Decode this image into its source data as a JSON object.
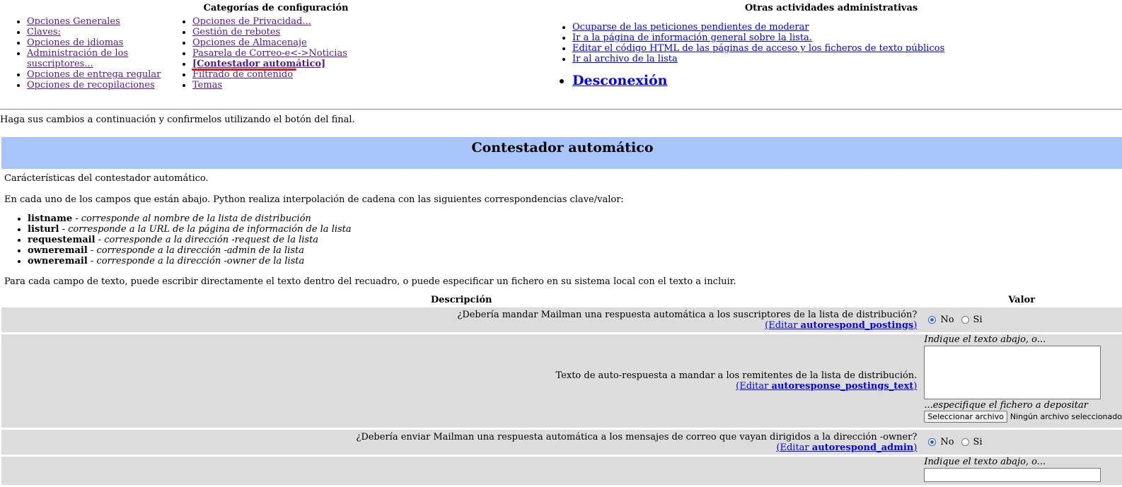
{
  "nav": {
    "config_heading": "Categorías de configuración",
    "config_list_1": [
      "Opciones Generales",
      "Claves:",
      "Opciones de idiomas",
      "Administración de los suscriptores...",
      "Opciones de entrega regular",
      "Opciones de recopilaciones"
    ],
    "config_list_2": [
      "Opciones de Privacidad...",
      "Gestión de rebotes",
      "Opciones de Almacenaje",
      "Pasarela de Correo-e<->Noticias",
      "[Contestador automático]",
      "Filtrado de contenido",
      "Temas"
    ],
    "admin_heading": "Otras actividades administrativas",
    "admin_list": [
      "Ocuparse de las peticiones pendientes de moderar",
      "Ir a la página de información general sobre la lista.",
      "Editar el código HTML de las páginas de acceso y los ficheros de texto públicos",
      "Ir al archivo de la lista"
    ],
    "logout": "Desconexión"
  },
  "intro": "Haga sus cambios a continuación y confirmelos utilizando el botón del final.",
  "section_title": "Contestador automático",
  "body": {
    "p1": "Carácterísticas del contestador automático.",
    "p2": "En cada uno de los campos que están abajo. Python realiza interpolación de cadena con las siguientes correspondencias clave/valor:",
    "keys": [
      {
        "key": "listname",
        "desc": "corresponde al nombre de la lista de distribución"
      },
      {
        "key": "listurl",
        "desc": "corresponde a la URL de la página de información de la lista"
      },
      {
        "key": "requestemail",
        "desc": "corresponde a la dirección -request de la lista"
      },
      {
        "key": "owneremail",
        "desc": "corresponde a la dirección -admin de la lista"
      },
      {
        "key": "owneremail",
        "desc": "corresponde a la dirección -owner de la lista"
      }
    ],
    "p3": "Para cada campo de texto, puede escribir directamente el texto dentro del recuadro, o puede especificar un fichero en su sistema local con el texto a incluir."
  },
  "table": {
    "col_desc": "Descripción",
    "col_value": "Valor",
    "edit_prefix": "(Editar ",
    "edit_suffix": ")",
    "radio_no": "No",
    "radio_yes": "Si",
    "hint_top": "Indique el texto abajo, o...",
    "hint_file": "...especifique el fichero a depositar",
    "file_button": "Seleccionar archivo",
    "file_none": "Ningún archivo seleccionado",
    "rows": [
      {
        "question": "¿Debería mandar Mailman una respuesta automática a los suscriptores de la lista de distribución?",
        "var": "autorespond_postings"
      },
      {
        "question": "Texto de auto-respuesta a mandar a los remitentes de la lista de distribución.",
        "var": "autoresponse_postings_text"
      },
      {
        "question": "¿Debería enviar Mailman una respuesta automática a los mensajes de correo que vayan dirigidos a la dirección -owner?",
        "var": "autorespond_admin"
      }
    ]
  }
}
